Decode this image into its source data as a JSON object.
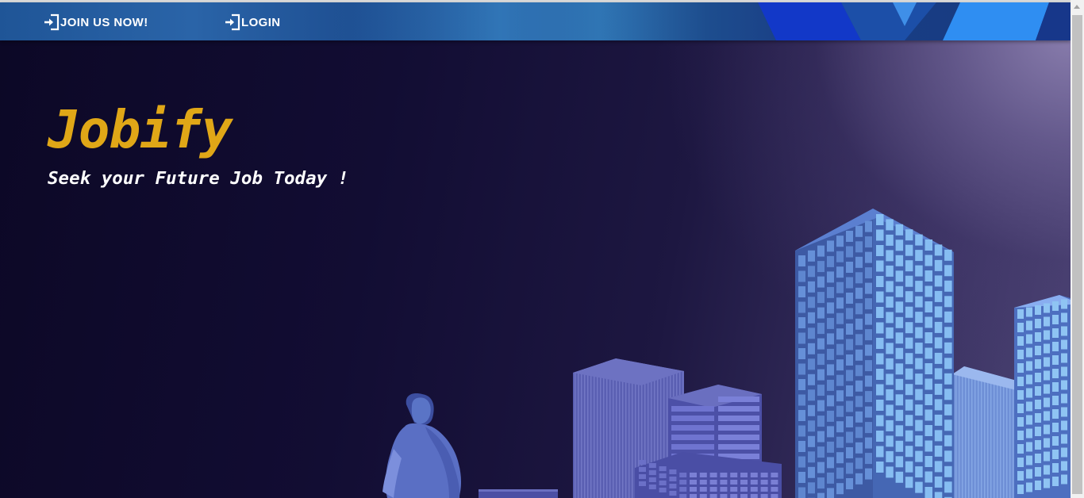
{
  "nav": {
    "join_label": "JOIN US NOW!",
    "login_label": "LOGIN",
    "icon": "sign-in-icon"
  },
  "hero": {
    "brand": "Jobify",
    "tagline": "Seek your Future Job Today !"
  },
  "colors": {
    "brand": "#e0a717",
    "navbar": "#1f5597",
    "background_dark": "#0c0826",
    "building": "#5b5fb0",
    "window_light": "#7fb6ef"
  },
  "illustration": "city-skyline-with-man"
}
